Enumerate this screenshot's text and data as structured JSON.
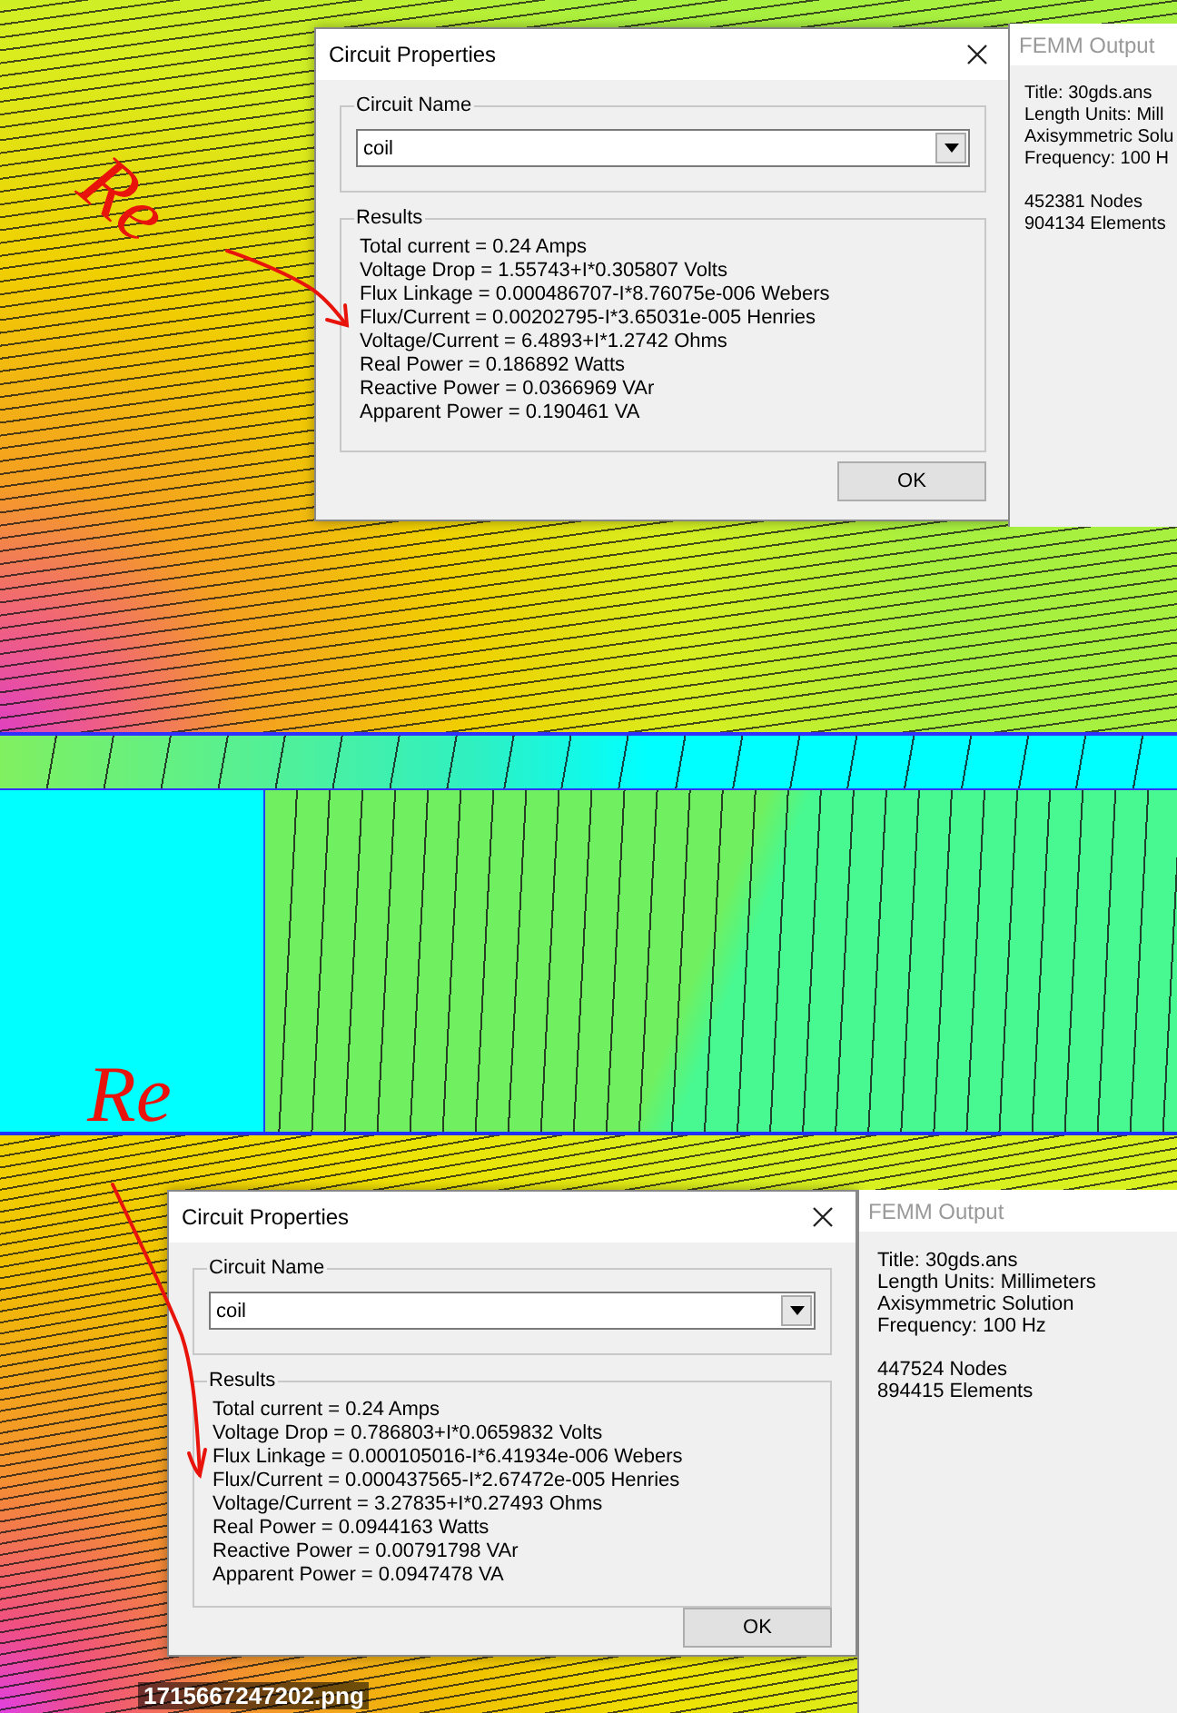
{
  "top_capture": {
    "annotation": "Re",
    "dialog": {
      "title": "Circuit Properties",
      "circuit_name_label": "Circuit Name",
      "circuit_name": "coil",
      "results_label": "Results",
      "results": [
        "Total current = 0.24 Amps",
        "Voltage Drop = 1.55743+I*0.305807 Volts",
        "Flux Linkage = 0.000486707-I*8.76075e-006 Webers",
        "Flux/Current = 0.00202795-I*3.65031e-005 Henries",
        "Voltage/Current = 6.4893+I*1.2742 Ohms",
        "Real Power = 0.186892 Watts",
        "Reactive Power = 0.0366969 VAr",
        "Apparent Power = 0.190461 VA"
      ],
      "ok_button": "OK"
    },
    "output_window": {
      "title": "FEMM Output",
      "info": [
        "Title: 30gds.ans",
        "Length Units: Mill",
        "Axisymmetric Solu",
        "Frequency: 100 H"
      ],
      "stats": [
        "452381 Nodes",
        "904134 Elements"
      ]
    }
  },
  "middle_capture": {
    "annotation": "Re"
  },
  "bottom_capture": {
    "dialog": {
      "title": "Circuit Properties",
      "circuit_name_label": "Circuit Name",
      "circuit_name": "coil",
      "results_label": "Results",
      "results": [
        "Total current = 0.24 Amps",
        "Voltage Drop = 0.786803+I*0.0659832 Volts",
        "Flux Linkage = 0.000105016-I*6.41934e-006 Webers",
        "Flux/Current = 0.000437565-I*2.67472e-005 Henries",
        "Voltage/Current = 3.27835+I*0.27493 Ohms",
        "Real Power = 0.0944163 Watts",
        "Reactive Power = 0.00791798 VAr",
        "Apparent Power = 0.0947478 VA"
      ],
      "ok_button": "OK"
    },
    "output_window": {
      "title": "FEMM Output",
      "info": [
        "Title: 30gds.ans",
        "Length Units: Millimeters",
        "Axisymmetric Solution",
        "Frequency: 100 Hz"
      ],
      "stats": [
        "447524 Nodes",
        "894415 Elements"
      ]
    }
  },
  "file_name": "1715667247202.png"
}
